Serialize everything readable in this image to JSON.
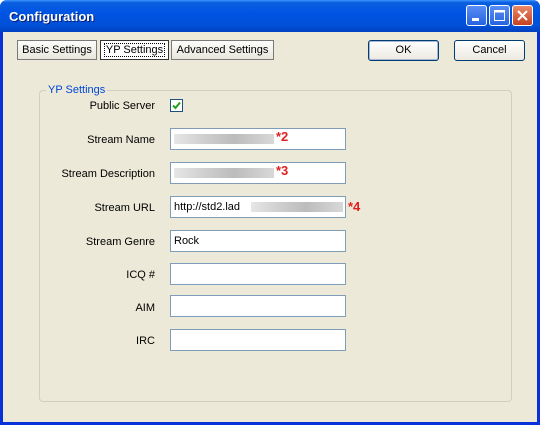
{
  "window": {
    "title": "Configuration"
  },
  "titlebar_buttons": {
    "minimize": "minimize-icon",
    "maximize": "maximize-icon",
    "close": "close-icon"
  },
  "tabs": [
    {
      "label": "Basic Settings"
    },
    {
      "label": "YP Settings"
    },
    {
      "label": "Advanced Settings"
    }
  ],
  "buttons": {
    "ok": "OK",
    "cancel": "Cancel"
  },
  "group": {
    "title": "YP Settings"
  },
  "fields": {
    "public_server": {
      "label": "Public Server",
      "checked": true
    },
    "stream_name": {
      "label": "Stream Name",
      "value": "",
      "annotation": "*2"
    },
    "stream_description": {
      "label": "Stream Description",
      "value": "",
      "annotation": "*3"
    },
    "stream_url": {
      "label": "Stream URL",
      "value": "http://std2.lad",
      "annotation": "*4"
    },
    "stream_genre": {
      "label": "Stream Genre",
      "value": "Rock"
    },
    "icq": {
      "label": "ICQ #",
      "value": ""
    },
    "aim": {
      "label": "AIM",
      "value": ""
    },
    "irc": {
      "label": "IRC",
      "value": ""
    }
  },
  "colors": {
    "titlebar": "#0054e3",
    "dialog_bg": "#ece9d8",
    "group_title": "#0046d5",
    "annotation": "#e02020",
    "checkmark": "#21a121"
  }
}
